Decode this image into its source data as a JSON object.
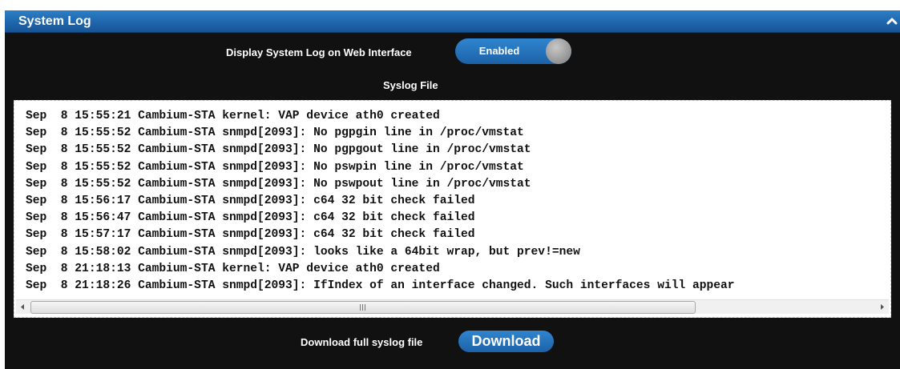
{
  "panel": {
    "title": "System Log",
    "collapse_icon": "chevron-up-icon"
  },
  "display_setting": {
    "label": "Display System Log on Web Interface",
    "toggle_state": "Enabled"
  },
  "syslog": {
    "heading": "Syslog File",
    "lines": [
      "Sep  8 15:55:21 Cambium-STA kernel: VAP device ath0 created",
      "Sep  8 15:55:52 Cambium-STA snmpd[2093]: No pgpgin line in /proc/vmstat",
      "Sep  8 15:55:52 Cambium-STA snmpd[2093]: No pgpgout line in /proc/vmstat",
      "Sep  8 15:55:52 Cambium-STA snmpd[2093]: No pswpin line in /proc/vmstat",
      "Sep  8 15:55:52 Cambium-STA snmpd[2093]: No pswpout line in /proc/vmstat",
      "Sep  8 15:56:17 Cambium-STA snmpd[2093]: c64 32 bit check failed",
      "Sep  8 15:56:47 Cambium-STA snmpd[2093]: c64 32 bit check failed",
      "Sep  8 15:57:17 Cambium-STA snmpd[2093]: c64 32 bit check failed",
      "Sep  8 15:58:02 Cambium-STA snmpd[2093]: looks like a 64bit wrap, but prev!=new",
      "Sep  8 21:18:13 Cambium-STA kernel: VAP device ath0 created",
      "Sep  8 21:18:26 Cambium-STA snmpd[2093]: IfIndex of an interface changed. Such interfaces will appear"
    ]
  },
  "download": {
    "label": "Download full syslog file",
    "button_label": "Download"
  },
  "colors": {
    "header_blue": "#1f66ad",
    "button_blue": "#2577bd",
    "panel_background": "#111111"
  }
}
